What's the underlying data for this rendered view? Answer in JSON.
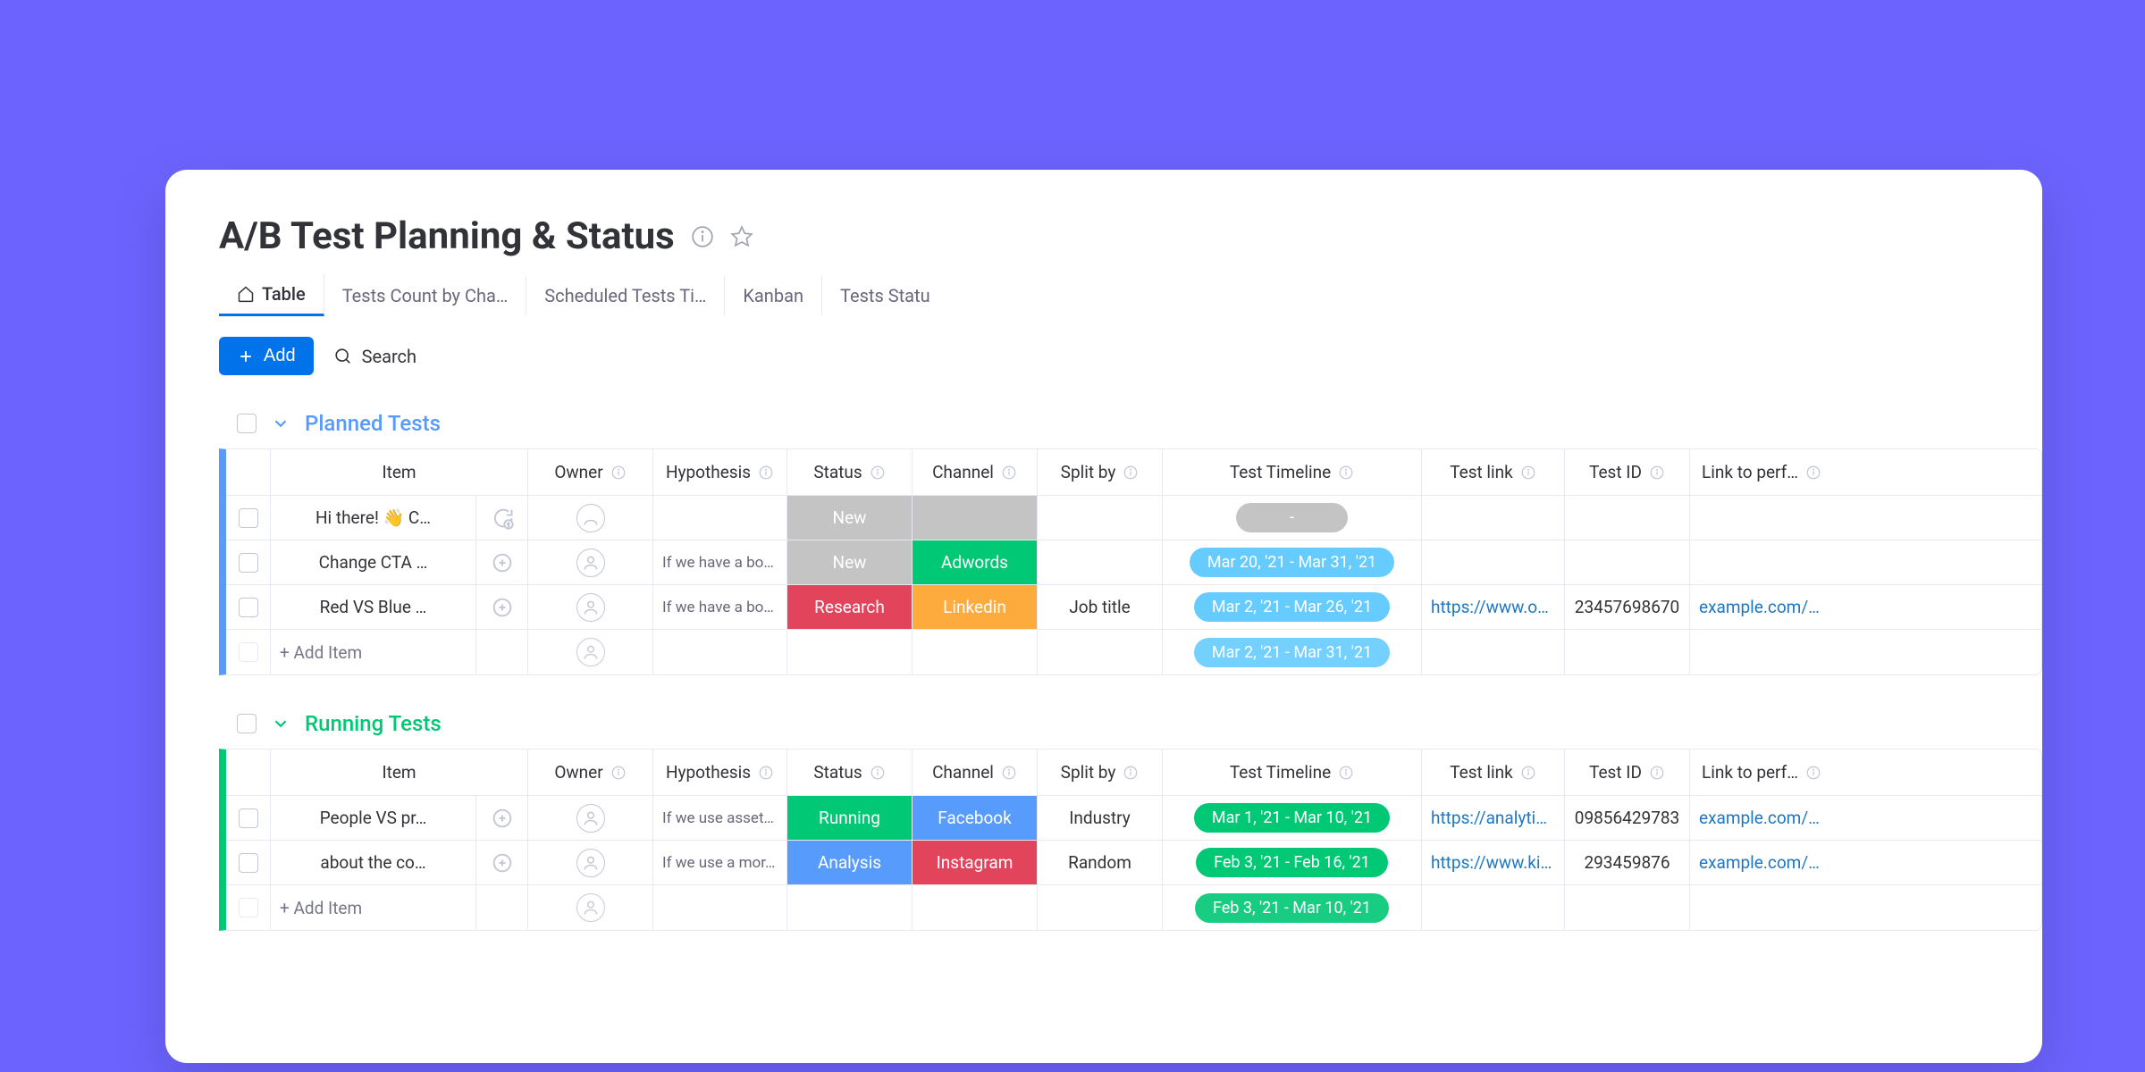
{
  "page": {
    "title": "A/B Test Planning & Status"
  },
  "tabs": {
    "0": {
      "label": "Table"
    },
    "1": {
      "label": "Tests Count by Cha…"
    },
    "2": {
      "label": "Scheduled Tests Ti…"
    },
    "3": {
      "label": "Kanban"
    },
    "4": {
      "label": "Tests Statu"
    }
  },
  "toolbar": {
    "add_label": "Add",
    "search_label": "Search"
  },
  "columns": {
    "item": "Item",
    "owner": "Owner",
    "hypothesis": "Hypothesis",
    "status": "Status",
    "channel": "Channel",
    "split_by": "Split by",
    "timeline": "Test Timeline",
    "test_link": "Test link",
    "test_id": "Test ID",
    "perf": "Link to perf…"
  },
  "groups": {
    "planned": {
      "title": "Planned Tests",
      "rows": {
        "0": {
          "item": "Hi there! 👋 C…",
          "hypothesis": "",
          "status_label": "New",
          "status_color": "gray",
          "channel_label": "",
          "channel_color": "gray",
          "split_by": "",
          "timeline": "-",
          "timeline_color": "gray",
          "test_link": "",
          "test_id": "",
          "perf": ""
        },
        "1": {
          "item": "Change CTA …",
          "hypothesis": "If we have a bou…",
          "status_label": "New",
          "status_color": "gray",
          "channel_label": "Adwords",
          "channel_color": "green",
          "split_by": "",
          "timeline": "Mar 20, '21 - Mar 31, '21",
          "timeline_color": "blue",
          "test_link": "",
          "test_id": "",
          "perf": ""
        },
        "2": {
          "item": "Red VS Blue …",
          "hypothesis": "If we have a bou…",
          "status_label": "Research",
          "status_color": "red",
          "channel_label": "Linkedin",
          "channel_color": "orange",
          "split_by": "Job title",
          "timeline": "Mar 2, '21 - Mar 26, '21",
          "timeline_color": "blue",
          "test_link": "https://www.opti…",
          "test_id": "23457698670",
          "perf": "example.com/ab…"
        }
      },
      "add_item": "+ Add Item",
      "add_timeline": "Mar 2, '21 - Mar 31, '21",
      "add_timeline_color": "blue"
    },
    "running": {
      "title": "Running Tests",
      "rows": {
        "0": {
          "item": "People VS pr…",
          "hypothesis": "If we use assets…",
          "status_label": "Running",
          "status_color": "green",
          "channel_label": "Facebook",
          "channel_color": "blue",
          "split_by": "Industry",
          "timeline": "Mar 1, '21 - Mar 10, '21",
          "timeline_color": "green",
          "test_link": "https://analytics…",
          "test_id": "09856429783",
          "perf": "example.com/ab…"
        },
        "1": {
          "item": "about the co…",
          "hypothesis": "If we use a mor…",
          "status_label": "Analysis",
          "status_color": "blue",
          "channel_label": "Instagram",
          "channel_color": "red",
          "split_by": "Random",
          "timeline": "Feb 3, '21 - Feb 16, '21",
          "timeline_color": "green",
          "test_link": "https://www.kis…",
          "test_id": "293459876",
          "perf": "example.com/ab…"
        }
      },
      "add_item": "+ Add Item",
      "add_timeline": "Feb 3, '21 - Mar 10, '21",
      "add_timeline_color": "green"
    }
  }
}
